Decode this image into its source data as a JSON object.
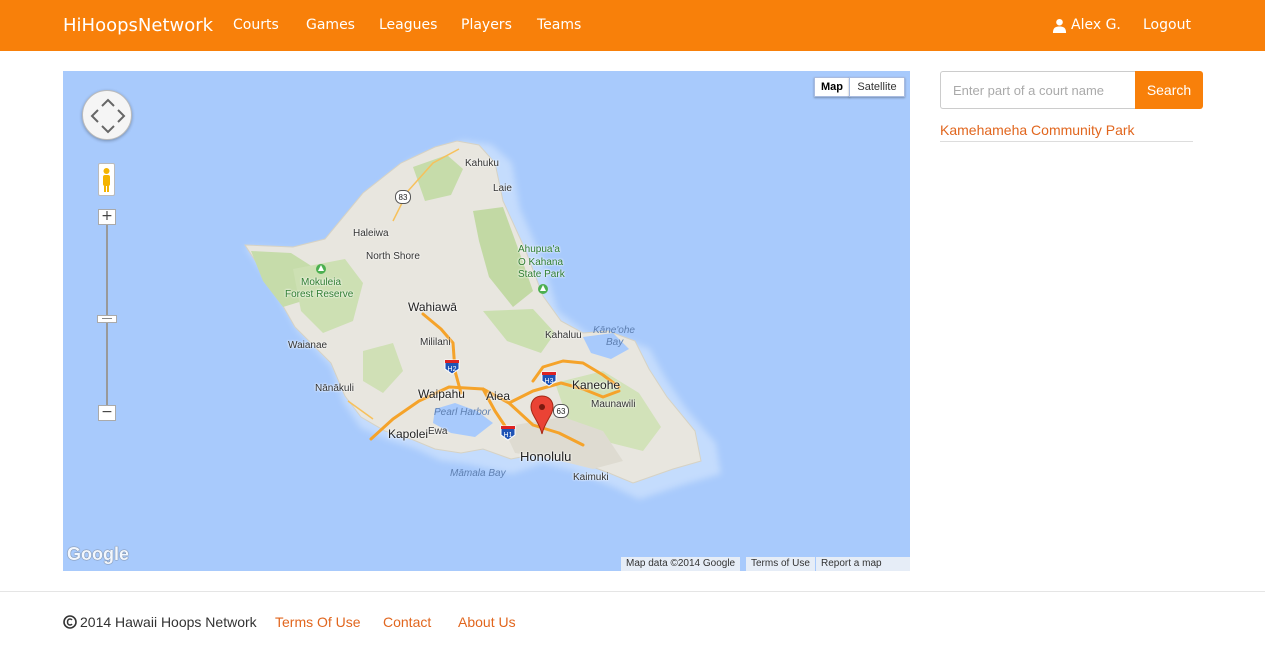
{
  "navbar": {
    "brand": "HiHoopsNetwork",
    "links": [
      "Courts",
      "Games",
      "Leagues",
      "Players",
      "Teams"
    ],
    "user_name": "Alex G.",
    "logout": "Logout",
    "color": "#f8800a"
  },
  "map": {
    "type_buttons": {
      "map": "Map",
      "satellite": "Satellite"
    },
    "places": {
      "kahuku": "Kahuku",
      "laie": "Laie",
      "haleiwa": "Haleiwa",
      "north_shore": "North Shore",
      "ahupuaa": "Ahupua'a",
      "o_kahana": "O Kahana",
      "state_park": "State Park",
      "mokuleia": "Mokuleia",
      "forest_reserve": "Forest Reserve",
      "wahiawa": "Wahiawā",
      "kaneohe_bay_1": "Kāne'ohe",
      "kaneohe_bay_2": "Bay",
      "kahaluu": "Kahaluu",
      "waianae": "Waianae",
      "mililani": "Mililani",
      "kaneohe": "Kaneohe",
      "nanakuli": "Nānākuli",
      "waipahu": "Waipahu",
      "aiea": "Aiea",
      "maunawili": "Maunawili",
      "pearl_harbor": "Pearl Harbor",
      "kapolei": "Kapolei",
      "ewa": "Ewa",
      "honolulu": "Honolulu",
      "mamala_bay": "Māmala Bay",
      "kaimuki": "Kaimuki"
    },
    "shields": {
      "h83": "83",
      "h2": "H2",
      "h3": "H3",
      "h63": "63",
      "h1": "H1"
    },
    "google_logo": "Google",
    "attribution": {
      "map_data": "Map data ©2014 Google",
      "terms": "Terms of Use",
      "report": "Report a map error"
    },
    "water_color": "#a8cafc",
    "land_color": "#e8e6df"
  },
  "search": {
    "placeholder": "Enter part of a court name",
    "button": "Search"
  },
  "results": [
    "Kamehameha Community Park"
  ],
  "footer": {
    "copyright": "2014 Hawaii Hoops Network",
    "links": [
      "Terms Of Use",
      "Contact",
      "About Us"
    ]
  }
}
